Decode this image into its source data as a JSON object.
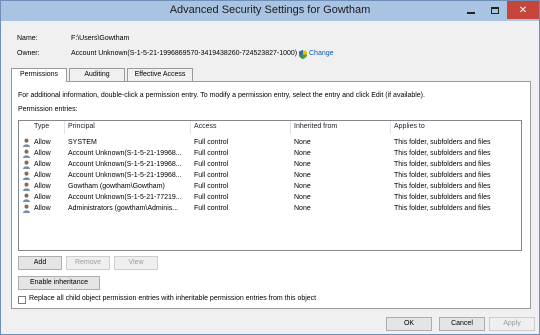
{
  "window": {
    "title": "Advanced Security Settings for Gowtham",
    "controls": {
      "minimize": "min-icon",
      "maximize": "max-icon",
      "close": "✕"
    }
  },
  "fields": {
    "name_label": "Name:",
    "name_value": "F:\\Users\\Gowtham",
    "owner_label": "Owner:",
    "owner_value": "Account Unknown(S-1-5-21-1996869570-3419438260-724523827-1000)",
    "change_link": "Change"
  },
  "tabs": [
    "Permissions",
    "Auditing",
    "Effective Access"
  ],
  "permissions": {
    "info": "For additional information, double-click a permission entry. To modify a permission entry, select the entry and click Edit (if available).",
    "entries_label": "Permission entries:",
    "columns": [
      "Type",
      "Principal",
      "Access",
      "Inherited from",
      "Applies to"
    ],
    "rows": [
      [
        "Allow",
        "SYSTEM",
        "Full control",
        "None",
        "This folder, subfolders and files"
      ],
      [
        "Allow",
        "Account Unknown(S-1-5-21-19968...",
        "Full control",
        "None",
        "This folder, subfolders and files"
      ],
      [
        "Allow",
        "Account Unknown(S-1-5-21-19968...",
        "Full control",
        "None",
        "This folder, subfolders and files"
      ],
      [
        "Allow",
        "Account Unknown(S-1-5-21-19968...",
        "Full control",
        "None",
        "This folder, subfolders and files"
      ],
      [
        "Allow",
        "Gowtham (gowtham\\Gowtham)",
        "Full control",
        "None",
        "This folder, subfolders and files"
      ],
      [
        "Allow",
        "Account Unknown(S-1-5-21-77219...",
        "Full control",
        "None",
        "This folder, subfolders and files"
      ],
      [
        "Allow",
        "Administrators (gowtham\\Adminis...",
        "Full control",
        "None",
        "This folder, subfolders and files"
      ]
    ],
    "add": "Add",
    "remove": "Remove",
    "view": "View",
    "enable_inheritance": "Enable inheritance",
    "replace_label": "Replace all child object permission entries with inheritable permission entries from this object"
  },
  "footer": {
    "ok": "OK",
    "cancel": "Cancel",
    "apply": "Apply"
  },
  "colors": {
    "titlebar": "#a9c3e3",
    "close": "#c7463c",
    "link": "#0a5cb8"
  }
}
